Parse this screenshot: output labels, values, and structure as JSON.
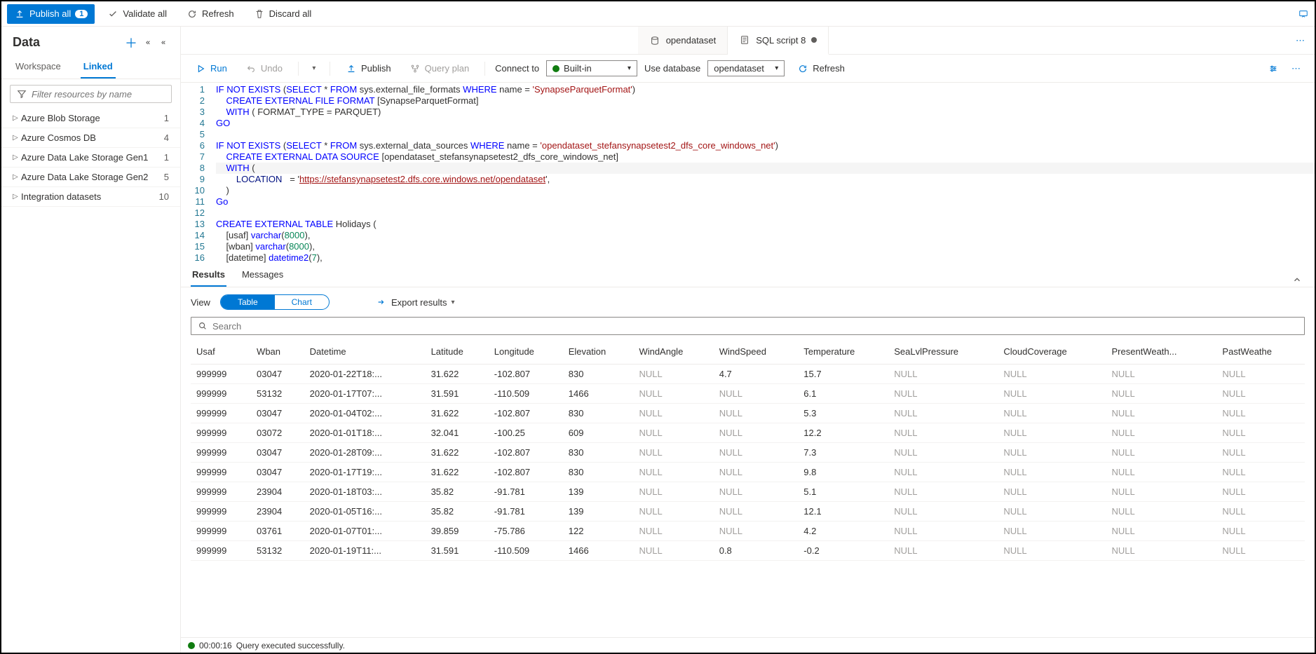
{
  "topbar": {
    "publish_label": "Publish all",
    "publish_count": "1",
    "validate_label": "Validate all",
    "refresh_label": "Refresh",
    "discard_label": "Discard all"
  },
  "sidebar": {
    "title": "Data",
    "tabs": {
      "workspace": "Workspace",
      "linked": "Linked"
    },
    "filter_placeholder": "Filter resources by name",
    "items": [
      {
        "label": "Azure Blob Storage",
        "count": "1"
      },
      {
        "label": "Azure Cosmos DB",
        "count": "4"
      },
      {
        "label": "Azure Data Lake Storage Gen1",
        "count": "1"
      },
      {
        "label": "Azure Data Lake Storage Gen2",
        "count": "5"
      },
      {
        "label": "Integration datasets",
        "count": "10"
      }
    ]
  },
  "tabs": [
    {
      "icon": "db",
      "label": "opendataset",
      "dirty": false
    },
    {
      "icon": "sql",
      "label": "SQL script 8",
      "dirty": true,
      "active": true
    }
  ],
  "editor_toolbar": {
    "run": "Run",
    "undo": "Undo",
    "publish": "Publish",
    "query_plan": "Query plan",
    "connect_label": "Connect to",
    "connect_value": "Built-in",
    "db_label": "Use database",
    "db_value": "opendataset",
    "refresh": "Refresh"
  },
  "code": [
    {
      "n": "1",
      "html": "<span class='kw'>IF</span> <span class='kw'>NOT</span> <span class='kw'>EXISTS</span> (<span class='kw'>SELECT</span> * <span class='kw'>FROM</span> sys.external_file_formats <span class='kw'>WHERE</span> name = <span class='str'>'SynapseParquetFormat'</span>)"
    },
    {
      "n": "2",
      "html": "    <span class='kw'>CREATE EXTERNAL FILE FORMAT</span> [SynapseParquetFormat]"
    },
    {
      "n": "3",
      "html": "    <span class='kw'>WITH</span> ( FORMAT_TYPE = PARQUET)"
    },
    {
      "n": "4",
      "html": "<span class='kw'>GO</span>"
    },
    {
      "n": "5",
      "html": ""
    },
    {
      "n": "6",
      "html": "<span class='kw'>IF</span> <span class='kw'>NOT</span> <span class='kw'>EXISTS</span> (<span class='kw'>SELECT</span> * <span class='kw'>FROM</span> sys.external_data_sources <span class='kw'>WHERE</span> name = <span class='str'>'opendataset_stefansynapsetest2_dfs_core_windows_net'</span>)"
    },
    {
      "n": "7",
      "html": "    <span class='kw'>CREATE EXTERNAL DATA SOURCE</span> [opendataset_stefansynapsetest2_dfs_core_windows_net]"
    },
    {
      "n": "8",
      "html": "    <span class='kw'>WITH</span> (",
      "cursor": true
    },
    {
      "n": "9",
      "html": "        <span class='ident'>LOCATION</span>   = '<span class='url'>https://stefansynapsetest2.dfs.core.windows.net/opendataset</span>',"
    },
    {
      "n": "10",
      "html": "    )"
    },
    {
      "n": "11",
      "html": "<span class='kw'>Go</span>"
    },
    {
      "n": "12",
      "html": ""
    },
    {
      "n": "13",
      "html": "<span class='kw'>CREATE EXTERNAL TABLE</span> Holidays ("
    },
    {
      "n": "14",
      "html": "    [usaf] <span class='kw'>varchar</span>(<span class='num'>8000</span>),"
    },
    {
      "n": "15",
      "html": "    [wban] <span class='kw'>varchar</span>(<span class='num'>8000</span>),"
    },
    {
      "n": "16",
      "html": "    [datetime] <span class='kw'>datetime2</span>(<span class='num'>7</span>),"
    }
  ],
  "results": {
    "tab_results": "Results",
    "tab_messages": "Messages",
    "view_label": "View",
    "toggle_table": "Table",
    "toggle_chart": "Chart",
    "export_label": "Export results",
    "search_placeholder": "Search",
    "columns": [
      "Usaf",
      "Wban",
      "Datetime",
      "Latitude",
      "Longitude",
      "Elevation",
      "WindAngle",
      "WindSpeed",
      "Temperature",
      "SeaLvlPressure",
      "CloudCoverage",
      "PresentWeath...",
      "PastWeathe"
    ],
    "rows": [
      [
        "999999",
        "03047",
        "2020-01-22T18:...",
        "31.622",
        "-102.807",
        "830",
        "NULL",
        "4.7",
        "15.7",
        "NULL",
        "NULL",
        "NULL",
        "NULL"
      ],
      [
        "999999",
        "53132",
        "2020-01-17T07:...",
        "31.591",
        "-110.509",
        "1466",
        "NULL",
        "NULL",
        "6.1",
        "NULL",
        "NULL",
        "NULL",
        "NULL"
      ],
      [
        "999999",
        "03047",
        "2020-01-04T02:...",
        "31.622",
        "-102.807",
        "830",
        "NULL",
        "NULL",
        "5.3",
        "NULL",
        "NULL",
        "NULL",
        "NULL"
      ],
      [
        "999999",
        "03072",
        "2020-01-01T18:...",
        "32.041",
        "-100.25",
        "609",
        "NULL",
        "NULL",
        "12.2",
        "NULL",
        "NULL",
        "NULL",
        "NULL"
      ],
      [
        "999999",
        "03047",
        "2020-01-28T09:...",
        "31.622",
        "-102.807",
        "830",
        "NULL",
        "NULL",
        "7.3",
        "NULL",
        "NULL",
        "NULL",
        "NULL"
      ],
      [
        "999999",
        "03047",
        "2020-01-17T19:...",
        "31.622",
        "-102.807",
        "830",
        "NULL",
        "NULL",
        "9.8",
        "NULL",
        "NULL",
        "NULL",
        "NULL"
      ],
      [
        "999999",
        "23904",
        "2020-01-18T03:...",
        "35.82",
        "-91.781",
        "139",
        "NULL",
        "NULL",
        "5.1",
        "NULL",
        "NULL",
        "NULL",
        "NULL"
      ],
      [
        "999999",
        "23904",
        "2020-01-05T16:...",
        "35.82",
        "-91.781",
        "139",
        "NULL",
        "NULL",
        "12.1",
        "NULL",
        "NULL",
        "NULL",
        "NULL"
      ],
      [
        "999999",
        "03761",
        "2020-01-07T01:...",
        "39.859",
        "-75.786",
        "122",
        "NULL",
        "NULL",
        "4.2",
        "NULL",
        "NULL",
        "NULL",
        "NULL"
      ],
      [
        "999999",
        "53132",
        "2020-01-19T11:...",
        "31.591",
        "-110.509",
        "1466",
        "NULL",
        "0.8",
        "-0.2",
        "NULL",
        "NULL",
        "NULL",
        "NULL"
      ]
    ]
  },
  "status": {
    "time": "00:00:16",
    "msg": "Query executed successfully."
  }
}
